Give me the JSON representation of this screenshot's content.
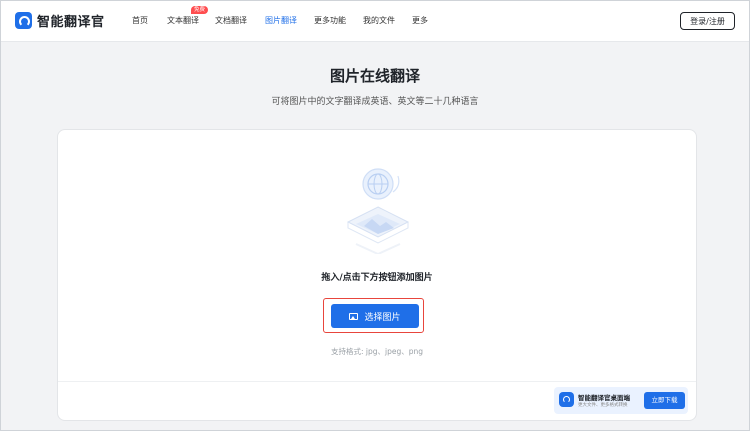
{
  "header": {
    "logo_text": "智能翻译官",
    "nav": [
      {
        "label": "首页"
      },
      {
        "label": "文本翻译"
      },
      {
        "label": "文档翻译"
      },
      {
        "label": "图片翻译",
        "active": true
      },
      {
        "label": "更多功能"
      },
      {
        "label": "我的文件"
      },
      {
        "label": "更多"
      }
    ],
    "badge": "免费",
    "login_label": "登录/注册"
  },
  "hero": {
    "title": "图片在线翻译",
    "subtitle": "可将图片中的文字翻译成英语、英文等二十几种语言"
  },
  "upload": {
    "drop_text": "拖入/点击下方按钮添加图片",
    "button_label": "选择图片",
    "formats": "支持格式: jpg、jpeg、png"
  },
  "promo": {
    "title": "智能翻译官桌面端",
    "subtitle": "更大文件、更多格式转换",
    "button_label": "立即下载"
  },
  "colors": {
    "accent": "#1f6fe8",
    "badge": "#ff4d4f",
    "highlight": "#e8453c"
  }
}
